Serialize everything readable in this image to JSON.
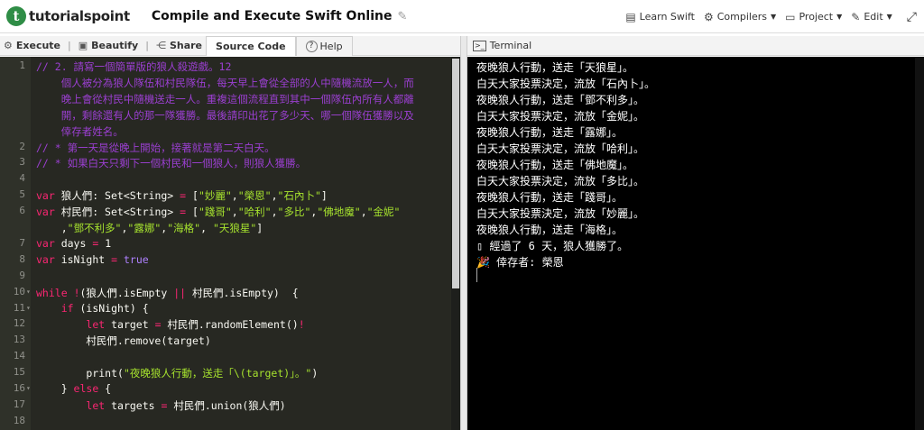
{
  "header": {
    "logo_mark": "t",
    "logo_text": "tutorialspoint",
    "title": "Compile and Execute Swift Online",
    "actions": [
      {
        "icon": "book-icon",
        "glyph": "▤",
        "label": "Learn Swift"
      },
      {
        "icon": "gear-icon",
        "glyph": "⚙",
        "label": "Compilers"
      },
      {
        "icon": "folder-icon",
        "glyph": "▭",
        "label": "Project"
      },
      {
        "icon": "edit-icon",
        "glyph": "✎",
        "label": "Edit"
      }
    ]
  },
  "toolbar": {
    "execute": "Execute",
    "beautify": "Beautify",
    "share": "Share",
    "source_code": "Source Code",
    "help": "Help"
  },
  "editor": {
    "line_numbers": [
      "1",
      "",
      "",
      "",
      "",
      "2",
      "3",
      "4",
      "5",
      "6",
      "",
      "7",
      "8",
      "9",
      "10",
      "11",
      "12",
      "13",
      "14",
      "15",
      "16",
      "17",
      "18"
    ],
    "lines": [
      "// 2. 請寫一個簡單版的狼人殺遊戲。12",
      "    個人被分為狼人隊伍和村民隊伍，每天早上會從全部的人中隨機流放一人，而",
      "    晚上會從村民中隨機送走一人。重複這個流程直到其中一個隊伍內所有人都離",
      "    開，剩餘還有人的那一隊獲勝。最後請印出花了多少天、哪一個隊伍獲勝以及",
      "    倖存者姓名。",
      "// * 第一天是從晚上開始，接著就是第二天白天。",
      "// * 如果白天只剩下一個村民和一個狼人，則狼人獲勝。",
      "",
      "var 狼人們: Set<String> = [\"妙麗\",\"榮恩\",\"石內卜\"]",
      "var 村民們: Set<String> = [\"踐哥\",\"哈利\",\"多比\",\"佛地魔\",\"金妮\"",
      "    ,\"鄧不利多\",\"露娜\",\"海格\", \"天狼星\"]",
      "var days = 1",
      "var isNight = true",
      "",
      "while !(狼人們.isEmpty || 村民們.isEmpty)  {",
      "    if (isNight) {",
      "        let target = 村民們.randomElement()!",
      "        村民們.remove(target)",
      "",
      "        print(\"夜晚狼人行動，送走「\\(target)」。\")",
      "    } else {",
      "        let targets = 村民們.union(狼人們)",
      ""
    ]
  },
  "terminal": {
    "title": "Terminal",
    "lines": [
      "夜晚狼人行動，送走「天狼星」。",
      "白天大家投票決定，流放「石內卜」。",
      "夜晚狼人行動，送走「鄧不利多」。",
      "白天大家投票決定，流放「金妮」。",
      "夜晚狼人行動，送走「露娜」。",
      "白天大家投票決定，流放「哈利」。",
      "夜晚狼人行動，送走「佛地魔」。",
      "白天大家投票決定，流放「多比」。",
      "夜晚狼人行動，送走「踐哥」。",
      "白天大家投票決定，流放「妙麗」。",
      "夜晚狼人行動，送走「海格」。",
      "▯ 經過了 6 天，狼人獲勝了。",
      "🎉 倖存者: 榮恩"
    ]
  }
}
